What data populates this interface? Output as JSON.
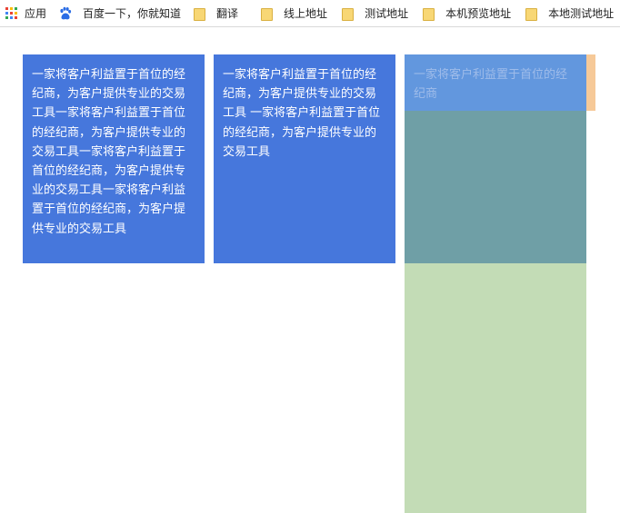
{
  "bookmarks_bar": {
    "items": [
      {
        "label": "应用",
        "icon": "apps-icon"
      },
      {
        "label": "百度一下，你就知道",
        "icon": "baidu-paw-icon"
      },
      {
        "label": "翻译",
        "icon": "folder-icon"
      },
      {
        "label": "线上地址",
        "icon": "folder-icon"
      },
      {
        "label": "测试地址",
        "icon": "folder-icon"
      },
      {
        "label": "本机预览地址",
        "icon": "folder-icon"
      },
      {
        "label": "本地测试地址",
        "icon": "folder-icon"
      }
    ]
  },
  "columns": {
    "col1_text": "一家将客户利益置于首位的经纪商，为客户提供专业的交易工具一家将客户利益置于首位的经纪商，为客户提供专业的交易工具一家将客户利益置于首位的经纪商，为客户提供专业的交易工具一家将客户利益置于首位的经纪商，为客户提供专业的交易工具",
    "col2_text": "一家将客户利益置于首位的经纪商，为客户提供专业的交易工具 一家将客户利益置于首位的经纪商，为客户提供专业的交易工具",
    "col3_text": "一家将客户利益置于首位的经纪商"
  },
  "colors": {
    "column_blue": "#4677dc",
    "col3_header_blue": "#6297de",
    "col3_teal": "#6f9fa6",
    "col3_green": "#c3dcb6",
    "orange_strip": "#f6c998",
    "folder_yellow": "#f8d775"
  }
}
